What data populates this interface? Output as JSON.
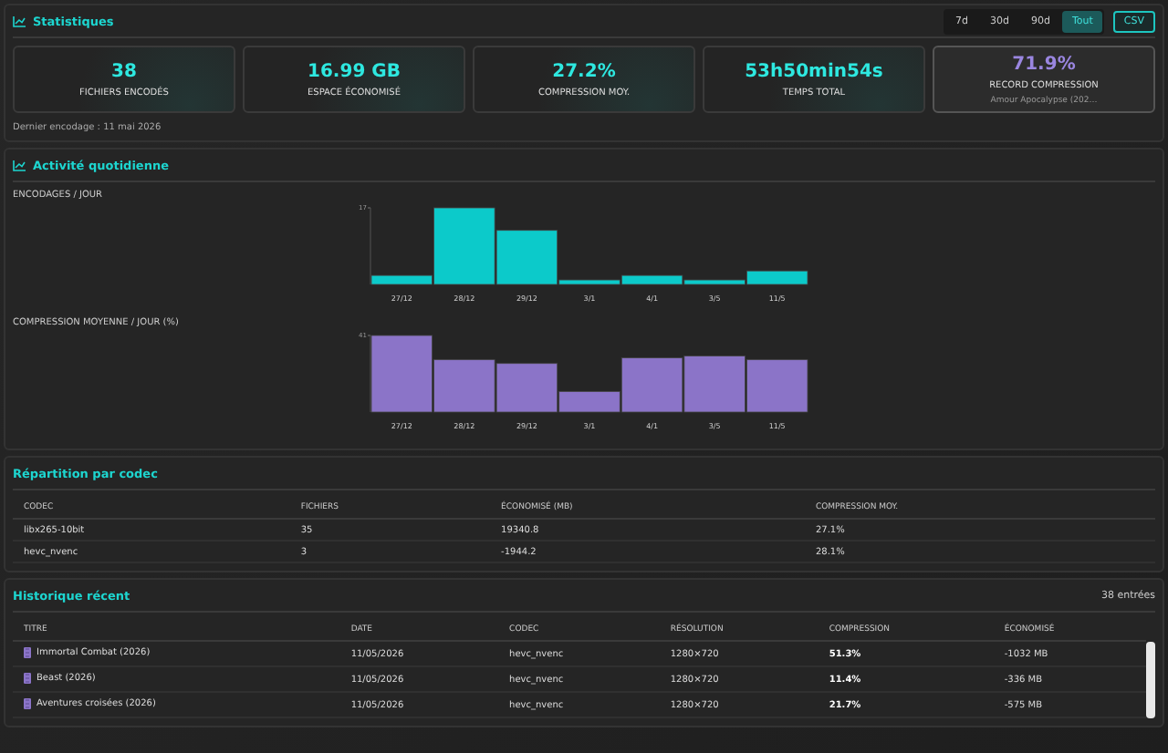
{
  "stats": {
    "title": "Statistiques",
    "ranges": [
      {
        "label": "7d",
        "selected": false
      },
      {
        "label": "30d",
        "selected": false
      },
      {
        "label": "90d",
        "selected": false
      },
      {
        "label": "Tout",
        "selected": true
      }
    ],
    "export_button": "CSV",
    "cards": [
      {
        "value": "38",
        "label": "FICHIERS ENCODÉS",
        "highlight": false
      },
      {
        "value": "16.99 GB",
        "label": "ESPACE ÉCONOMISÉ",
        "highlight": false
      },
      {
        "value": "27.2%",
        "label": "COMPRESSION MOY.",
        "highlight": false
      },
      {
        "value": "53h50min54s",
        "label": "TEMPS TOTAL",
        "highlight": false
      },
      {
        "value": "71.9%",
        "label": "RECORD COMPRESSION",
        "detail": "Amour Apocalypse (202…",
        "highlight": true
      }
    ],
    "last_encode": "Dernier encodage : 11 mai 2026"
  },
  "activity": {
    "title": "Activité quotidienne",
    "charts": [
      {
        "label": "ENCODAGES / JOUR",
        "chart_data": {
          "type": "bar",
          "categories": [
            "27/12",
            "28/12",
            "29/12",
            "3/1",
            "4/1",
            "3/5",
            "11/5"
          ],
          "series": [
            {
              "color": "#0ccaca",
              "values": [
                2,
                17,
                12,
                1,
                2,
                1,
                3
              ]
            }
          ],
          "ylim": [
            0,
            17
          ],
          "yticks": [
            17
          ]
        }
      },
      {
        "label": "COMPRESSION MOYENNE / JOUR (%)",
        "chart_data": {
          "type": "bar",
          "categories": [
            "27/12",
            "28/12",
            "29/12",
            "3/1",
            "4/1",
            "3/5",
            "11/5"
          ],
          "series": [
            {
              "color": "#8b74c8",
              "values": [
                41,
                28,
                26,
                11,
                29,
                30,
                28
              ]
            }
          ],
          "ylim": [
            0,
            41
          ],
          "yticks": [
            41
          ]
        }
      }
    ]
  },
  "codecs": {
    "title": "Répartition par codec",
    "columns": [
      "CODEC",
      "FICHIERS",
      "ÉCONOMISÉ (MB)",
      "COMPRESSION MOY."
    ],
    "rows": [
      [
        "libx265-10bit",
        "35",
        "19340.8",
        "27.1%"
      ],
      [
        "hevc_nvenc",
        "3",
        "-1944.2",
        "28.1%"
      ]
    ]
  },
  "history": {
    "title": "Historique récent",
    "count": "38 entrées",
    "columns": [
      "TITRE",
      "DATE",
      "CODEC",
      "RÉSOLUTION",
      "COMPRESSION",
      "ÉCONOMISÉ"
    ],
    "rows": [
      [
        "Immortal Combat (2026)",
        "11/05/2026",
        "hevc_nvenc",
        "1280×720",
        "51.3%",
        "-1032 MB"
      ],
      [
        "Beast (2026)",
        "11/05/2026",
        "hevc_nvenc",
        "1280×720",
        "11.4%",
        "-336 MB"
      ],
      [
        "Aventures croisées (2026)",
        "11/05/2026",
        "hevc_nvenc",
        "1280×720",
        "21.7%",
        "-575 MB"
      ]
    ]
  }
}
